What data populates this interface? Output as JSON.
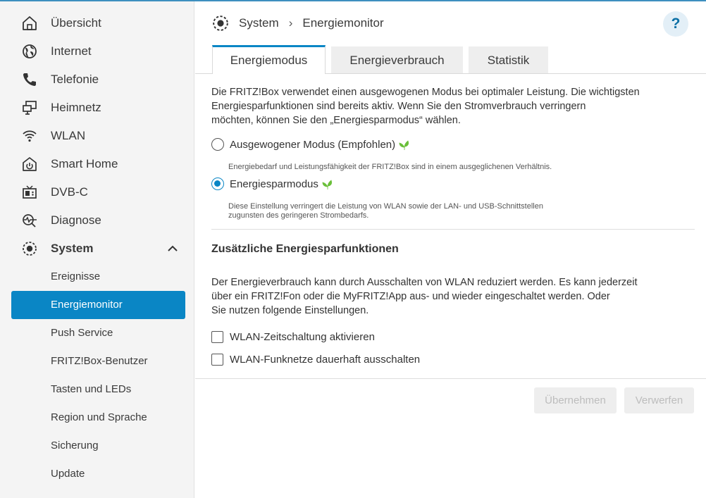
{
  "sidebar": {
    "items": [
      {
        "label": "Übersicht",
        "icon": "home-icon"
      },
      {
        "label": "Internet",
        "icon": "globe-icon"
      },
      {
        "label": "Telefonie",
        "icon": "phone-icon"
      },
      {
        "label": "Heimnetz",
        "icon": "network-icon"
      },
      {
        "label": "WLAN",
        "icon": "wifi-icon"
      },
      {
        "label": "Smart Home",
        "icon": "smart-home-icon"
      },
      {
        "label": "DVB-C",
        "icon": "tv-icon"
      },
      {
        "label": "Diagnose",
        "icon": "diagnose-icon"
      },
      {
        "label": "System",
        "icon": "system-icon",
        "expanded": true
      }
    ],
    "sub_items": [
      {
        "label": "Ereignisse"
      },
      {
        "label": "Energiemonitor",
        "active": true
      },
      {
        "label": "Push Service"
      },
      {
        "label": "FRITZ!Box-Benutzer"
      },
      {
        "label": "Tasten und LEDs"
      },
      {
        "label": "Region und Sprache"
      },
      {
        "label": "Sicherung"
      },
      {
        "label": "Update"
      }
    ]
  },
  "breadcrumb": {
    "section": "System",
    "page": "Energiemonitor"
  },
  "help_label": "?",
  "tabs": [
    {
      "label": "Energiemodus",
      "active": true
    },
    {
      "label": "Energieverbrauch"
    },
    {
      "label": "Statistik"
    }
  ],
  "intro": {
    "line1": "Die FRITZ!Box verwendet einen ausgewogenen Modus bei optimaler Leistung. Die wichtigsten",
    "line2": "Energiesparfunktionen sind bereits aktiv. Wenn Sie den Stromverbrauch verringern",
    "line3": "möchten, können Sie den „Energiesparmodus“ wählen."
  },
  "modes": {
    "balanced": {
      "label": "Ausgewogener Modus (Empfohlen)",
      "hint": "Energiebedarf und Leistungsfähigkeit der FRITZ!Box sind in einem ausgeglichenen Verhältnis.",
      "selected": false
    },
    "saving": {
      "label": "Energiesparmodus",
      "hint_line1": "Diese Einstellung verringert die Leistung von WLAN sowie der LAN- und USB-Schnittstellen",
      "hint_line2": "zugunsten des geringeren Strombedarfs.",
      "selected": true
    }
  },
  "extra": {
    "title": "Zusätzliche Energiesparfunktionen",
    "line1": "Der Energieverbrauch kann durch Ausschalten von WLAN reduziert werden. Es kann jederzeit",
    "line2": "über ein FRITZ!Fon oder die MyFRITZ!App aus- und wieder eingeschaltet werden. Oder",
    "line3": "Sie nutzen folgende Einstellungen.",
    "checkbox1": {
      "label": "WLAN-Zeitschaltung aktivieren",
      "checked": false
    },
    "checkbox2": {
      "label": "WLAN-Funknetze dauerhaft ausschalten",
      "checked": false
    }
  },
  "buttons": {
    "apply": "Übernehmen",
    "discard": "Verwerfen"
  },
  "colors": {
    "accent": "#0a86c5",
    "leaf": "#6abf3a",
    "sidebar_bg": "#f4f4f4"
  }
}
